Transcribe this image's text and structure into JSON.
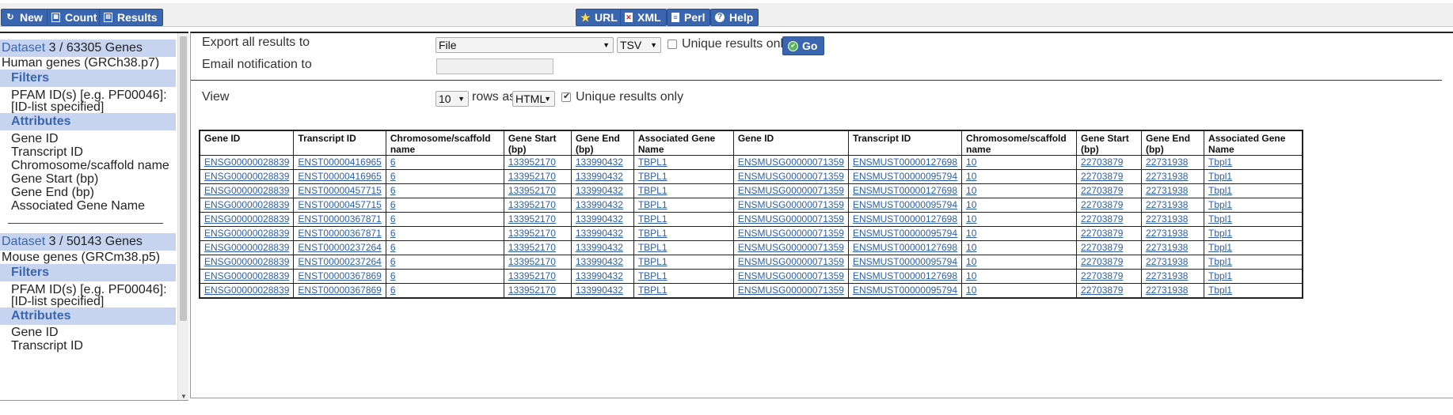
{
  "toolbar": {
    "new_label": "New",
    "count_label": "Count",
    "results_label": "Results",
    "url_label": "URL",
    "xml_label": "XML",
    "perl_label": "Perl",
    "help_label": "Help"
  },
  "sidebar": {
    "datasets": [
      {
        "dataset_word": "Dataset",
        "count": "3 / 63305 Genes",
        "name": "Human genes (GRCh38.p7)",
        "filters_label": "Filters",
        "filters": [
          "PFAM ID(s) [e.g. PF00046]:",
          "[ID-list specified]"
        ],
        "attributes_label": "Attributes",
        "attributes": [
          "Gene ID",
          "Transcript ID",
          "Chromosome/scaffold name",
          "Gene Start (bp)",
          "Gene End (bp)",
          "Associated Gene Name"
        ]
      },
      {
        "dataset_word": "Dataset",
        "count": "3 / 50143 Genes",
        "name": "Mouse genes (GRCm38.p5)",
        "filters_label": "Filters",
        "filters": [
          "PFAM ID(s) [e.g. PF00046]:",
          "[ID-list specified]"
        ],
        "attributes_label": "Attributes",
        "attributes": [
          "Gene ID",
          "Transcript ID"
        ]
      }
    ]
  },
  "export": {
    "label": "Export  all results to",
    "destination": "File",
    "format": "TSV",
    "unique_label": "Unique results only",
    "unique_checked": false,
    "go_label": "Go",
    "email_label": "Email notification to",
    "email_value": ""
  },
  "view": {
    "label": "View",
    "rows": "10",
    "rows_as_label": "rows as",
    "format": "HTML",
    "unique_label": "Unique results only",
    "unique_checked": true
  },
  "table": {
    "headers": [
      "Gene ID",
      "Transcript ID",
      "Chromosome/scaffold name",
      "Gene Start (bp)",
      "Gene End (bp)",
      "Associated Gene Name",
      "Gene ID",
      "Transcript ID",
      "Chromosome/scaffold name",
      "Gene Start (bp)",
      "Gene End (bp)",
      "Associated Gene Name"
    ],
    "rows": [
      [
        "ENSG00000028839",
        "ENST00000416965",
        "6",
        "133952170",
        "133990432",
        "TBPL1",
        "ENSMUSG00000071359",
        "ENSMUST00000127698",
        "10",
        "22703879",
        "22731938",
        "Tbpl1"
      ],
      [
        "ENSG00000028839",
        "ENST00000416965",
        "6",
        "133952170",
        "133990432",
        "TBPL1",
        "ENSMUSG00000071359",
        "ENSMUST00000095794",
        "10",
        "22703879",
        "22731938",
        "Tbpl1"
      ],
      [
        "ENSG00000028839",
        "ENST00000457715",
        "6",
        "133952170",
        "133990432",
        "TBPL1",
        "ENSMUSG00000071359",
        "ENSMUST00000127698",
        "10",
        "22703879",
        "22731938",
        "Tbpl1"
      ],
      [
        "ENSG00000028839",
        "ENST00000457715",
        "6",
        "133952170",
        "133990432",
        "TBPL1",
        "ENSMUSG00000071359",
        "ENSMUST00000095794",
        "10",
        "22703879",
        "22731938",
        "Tbpl1"
      ],
      [
        "ENSG00000028839",
        "ENST00000367871",
        "6",
        "133952170",
        "133990432",
        "TBPL1",
        "ENSMUSG00000071359",
        "ENSMUST00000127698",
        "10",
        "22703879",
        "22731938",
        "Tbpl1"
      ],
      [
        "ENSG00000028839",
        "ENST00000367871",
        "6",
        "133952170",
        "133990432",
        "TBPL1",
        "ENSMUSG00000071359",
        "ENSMUST00000095794",
        "10",
        "22703879",
        "22731938",
        "Tbpl1"
      ],
      [
        "ENSG00000028839",
        "ENST00000237264",
        "6",
        "133952170",
        "133990432",
        "TBPL1",
        "ENSMUSG00000071359",
        "ENSMUST00000127698",
        "10",
        "22703879",
        "22731938",
        "Tbpl1"
      ],
      [
        "ENSG00000028839",
        "ENST00000237264",
        "6",
        "133952170",
        "133990432",
        "TBPL1",
        "ENSMUSG00000071359",
        "ENSMUST00000095794",
        "10",
        "22703879",
        "22731938",
        "Tbpl1"
      ],
      [
        "ENSG00000028839",
        "ENST00000367869",
        "6",
        "133952170",
        "133990432",
        "TBPL1",
        "ENSMUSG00000071359",
        "ENSMUST00000127698",
        "10",
        "22703879",
        "22731938",
        "Tbpl1"
      ],
      [
        "ENSG00000028839",
        "ENST00000367869",
        "6",
        "133952170",
        "133990432",
        "TBPL1",
        "ENSMUSG00000071359",
        "ENSMUST00000095794",
        "10",
        "22703879",
        "22731938",
        "Tbpl1"
      ]
    ]
  },
  "icons": {
    "new": "refresh-icon",
    "count": "calculator-icon",
    "results": "table-icon",
    "url": "star-icon",
    "xml": "xml-file-icon",
    "perl": "perl-file-icon",
    "help": "help-icon",
    "go": "check-circle-icon"
  },
  "colors": {
    "button_blue": "#3a66b0",
    "panel_header": "#c6d4ef",
    "link": "#2d5fa8"
  }
}
